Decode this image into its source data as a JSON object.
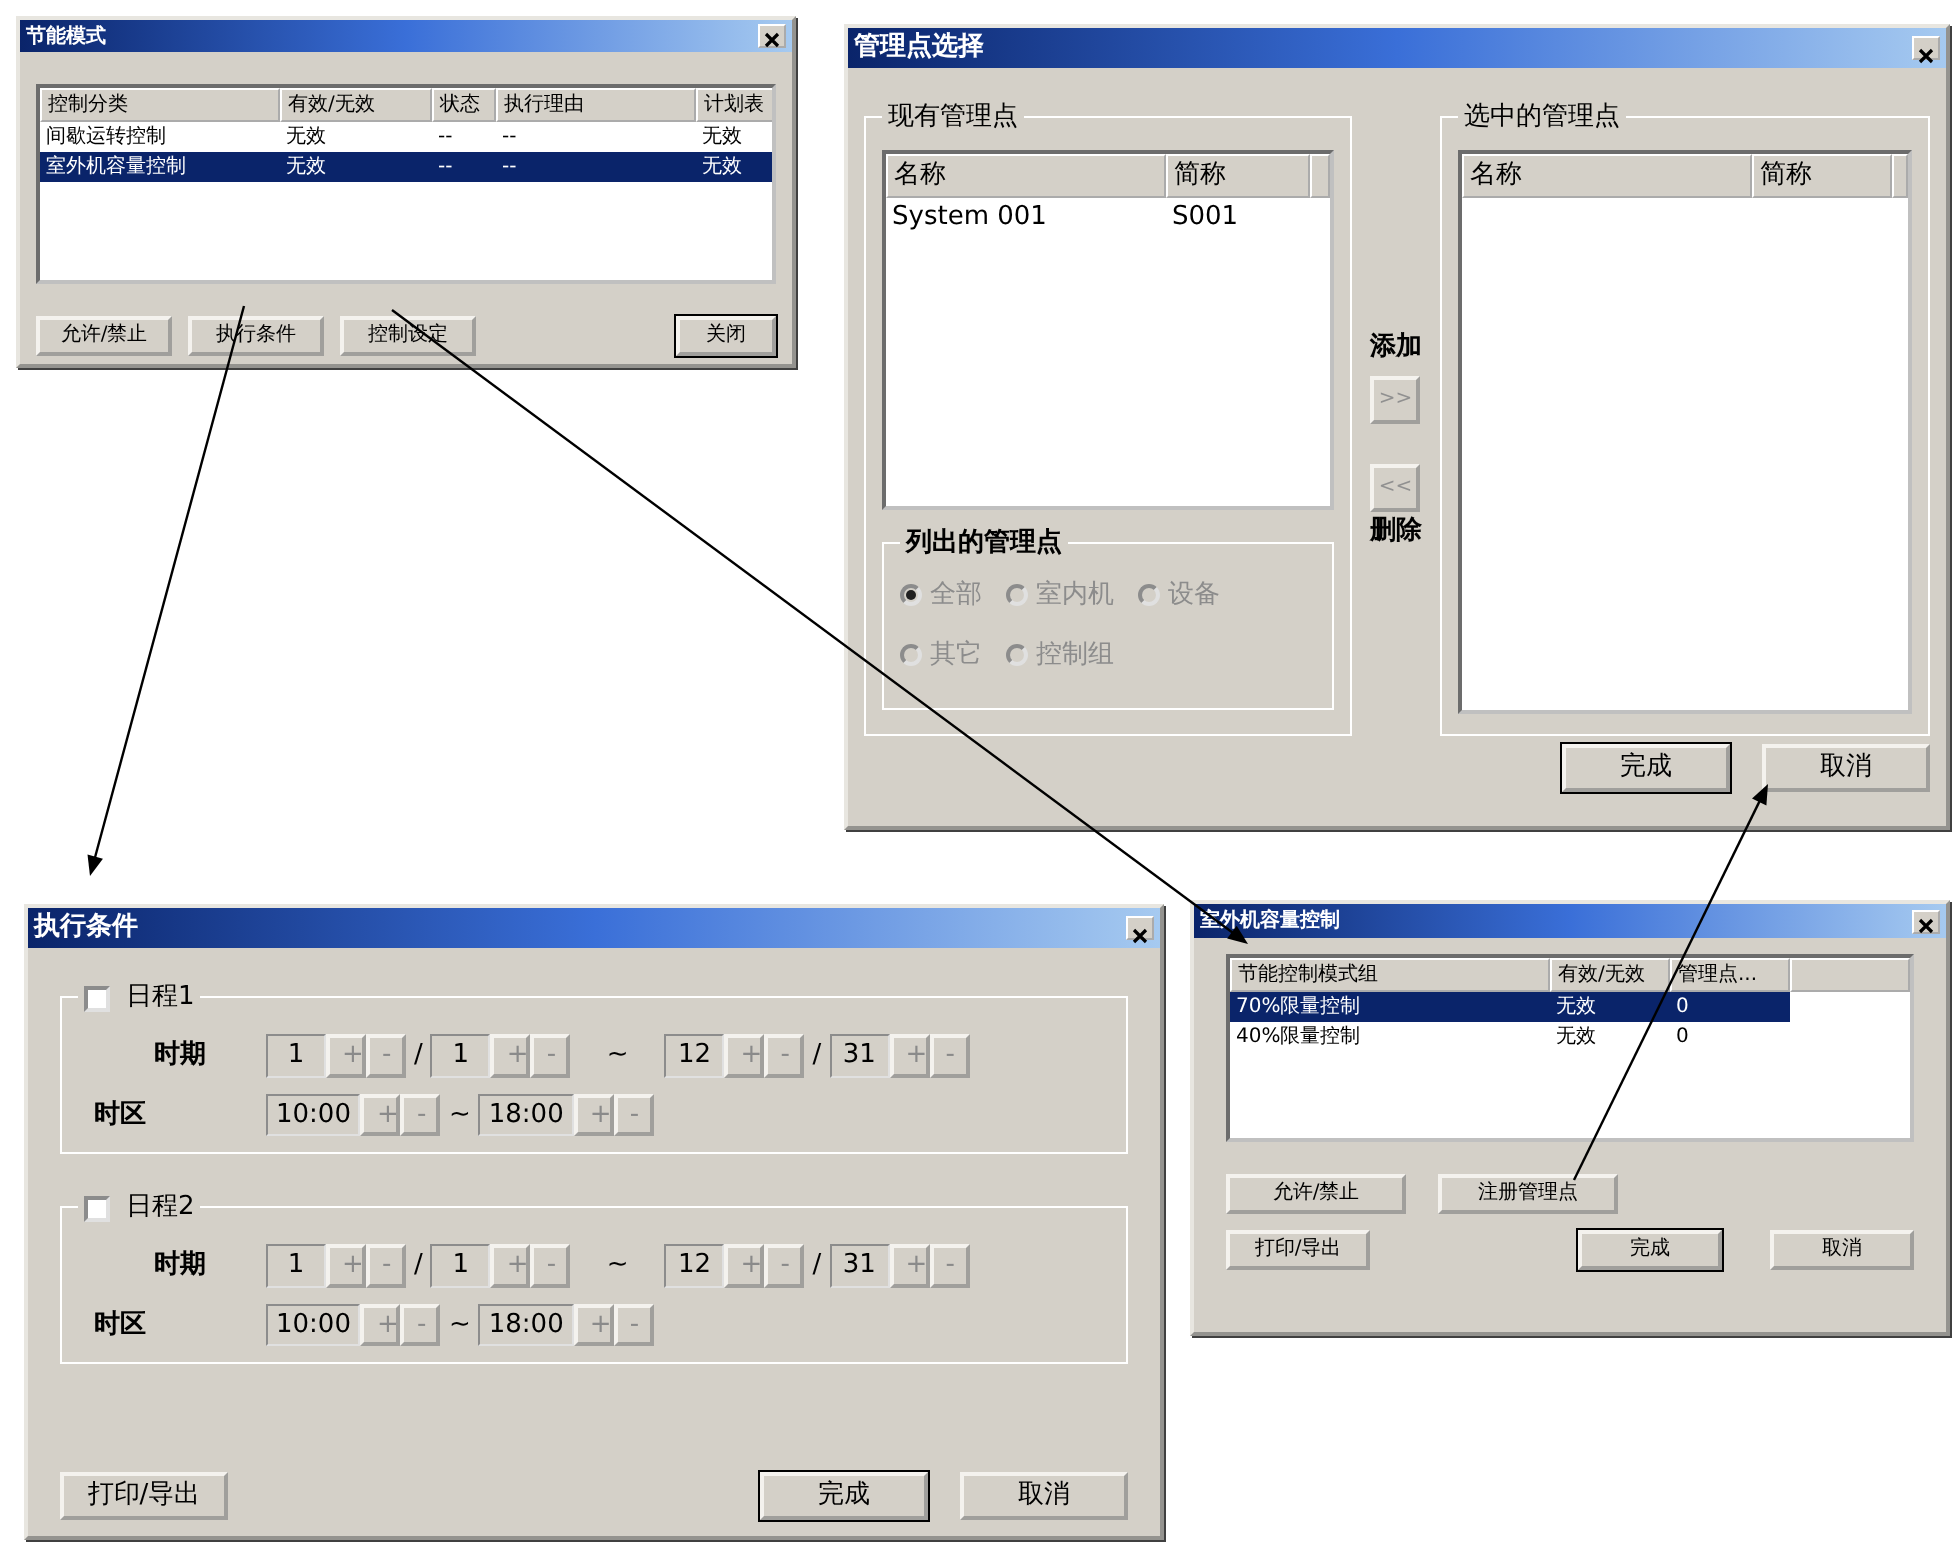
{
  "energy_mode_dialog": {
    "title": "节能模式",
    "columns": [
      "控制分类",
      "有效/无效",
      "状态",
      "执行理由",
      "计划表"
    ],
    "rows": [
      {
        "cells": [
          "间歇运转控制",
          "无效",
          "--",
          "--",
          "无效"
        ],
        "selected": false
      },
      {
        "cells": [
          "室外机容量控制",
          "无效",
          "--",
          "--",
          "无效"
        ],
        "selected": true
      }
    ],
    "buttons": [
      {
        "label": "允许/禁止",
        "default": false
      },
      {
        "label": "执行条件",
        "default": false
      },
      {
        "label": "控制设定",
        "default": false
      }
    ],
    "close_button": {
      "label": "关闭",
      "default": true
    }
  },
  "point_select_dialog": {
    "title": "管理点选择",
    "existing": {
      "title": "现有管理点",
      "columns": [
        "名称",
        "简称"
      ],
      "rows": [
        {
          "cells": [
            "System 001",
            "S001"
          ],
          "selected": false
        }
      ]
    },
    "add_label": "添加",
    "add_button": {
      "label": ">>",
      "disabled": true
    },
    "remove_button": {
      "label": "<<",
      "disabled": true
    },
    "remove_label": "删除",
    "filter": {
      "title": "列出的管理点",
      "disabled": true,
      "options": [
        {
          "label": "全部",
          "selected": true
        },
        {
          "label": "室内机",
          "selected": false
        },
        {
          "label": "设备",
          "selected": false
        },
        {
          "label": "其它",
          "selected": false
        },
        {
          "label": "控制组",
          "selected": false
        }
      ]
    },
    "chosen": {
      "title": "选中的管理点",
      "columns": [
        "名称",
        "简称"
      ]
    },
    "buttons": [
      {
        "label": "完成",
        "default": true
      },
      {
        "label": "取消",
        "default": false
      }
    ]
  },
  "exec_condition_dialog": {
    "title": "执行条件",
    "schedules": [
      {
        "label": "日程1",
        "checked": false,
        "period_label": "时期",
        "period": [
          {
            "value": "1",
            "up": "+",
            "down": "-"
          },
          {
            "value": "1",
            "up": "+",
            "down": "-"
          },
          {
            "value": "12",
            "up": "+",
            "down": "-"
          },
          {
            "value": "31",
            "up": "+",
            "down": "-"
          }
        ],
        "period_separators": [
          "/",
          "~",
          "/"
        ],
        "zone_label": "时区",
        "zone": [
          {
            "value": "10:00",
            "up": "+",
            "down": "-"
          },
          {
            "value": "18:00",
            "up": "+",
            "down": "-"
          }
        ],
        "zone_separator": "~"
      },
      {
        "label": "日程2",
        "checked": false,
        "period_label": "时期",
        "period": [
          {
            "value": "1",
            "up": "+",
            "down": "-"
          },
          {
            "value": "1",
            "up": "+",
            "down": "-"
          },
          {
            "value": "12",
            "up": "+",
            "down": "-"
          },
          {
            "value": "31",
            "up": "+",
            "down": "-"
          }
        ],
        "period_separators": [
          "/",
          "~",
          "/"
        ],
        "zone_label": "时区",
        "zone": [
          {
            "value": "10:00",
            "up": "+",
            "down": "-"
          },
          {
            "value": "18:00",
            "up": "+",
            "down": "-"
          }
        ],
        "zone_separator": "~"
      }
    ],
    "buttons": [
      {
        "label": "打印/导出",
        "default": false
      },
      {
        "label": "完成",
        "default": true
      },
      {
        "label": "取消",
        "default": false
      }
    ]
  },
  "capacity_dialog": {
    "title": "室外机容量控制",
    "columns": [
      "节能控制模式组",
      "有效/无效",
      "管理点..."
    ],
    "rows": [
      {
        "cells": [
          "70%限量控制",
          "无效",
          "0"
        ],
        "selected": true
      },
      {
        "cells": [
          "40%限量控制",
          "无效",
          "0"
        ],
        "selected": false
      }
    ],
    "buttons": [
      {
        "label": "允许/禁止",
        "default": false
      },
      {
        "label": "注册管理点",
        "default": false
      }
    ],
    "footer_buttons": [
      {
        "label": "打印/导出",
        "default": false
      },
      {
        "label": "完成",
        "default": true
      },
      {
        "label": "取消",
        "default": false
      }
    ]
  }
}
